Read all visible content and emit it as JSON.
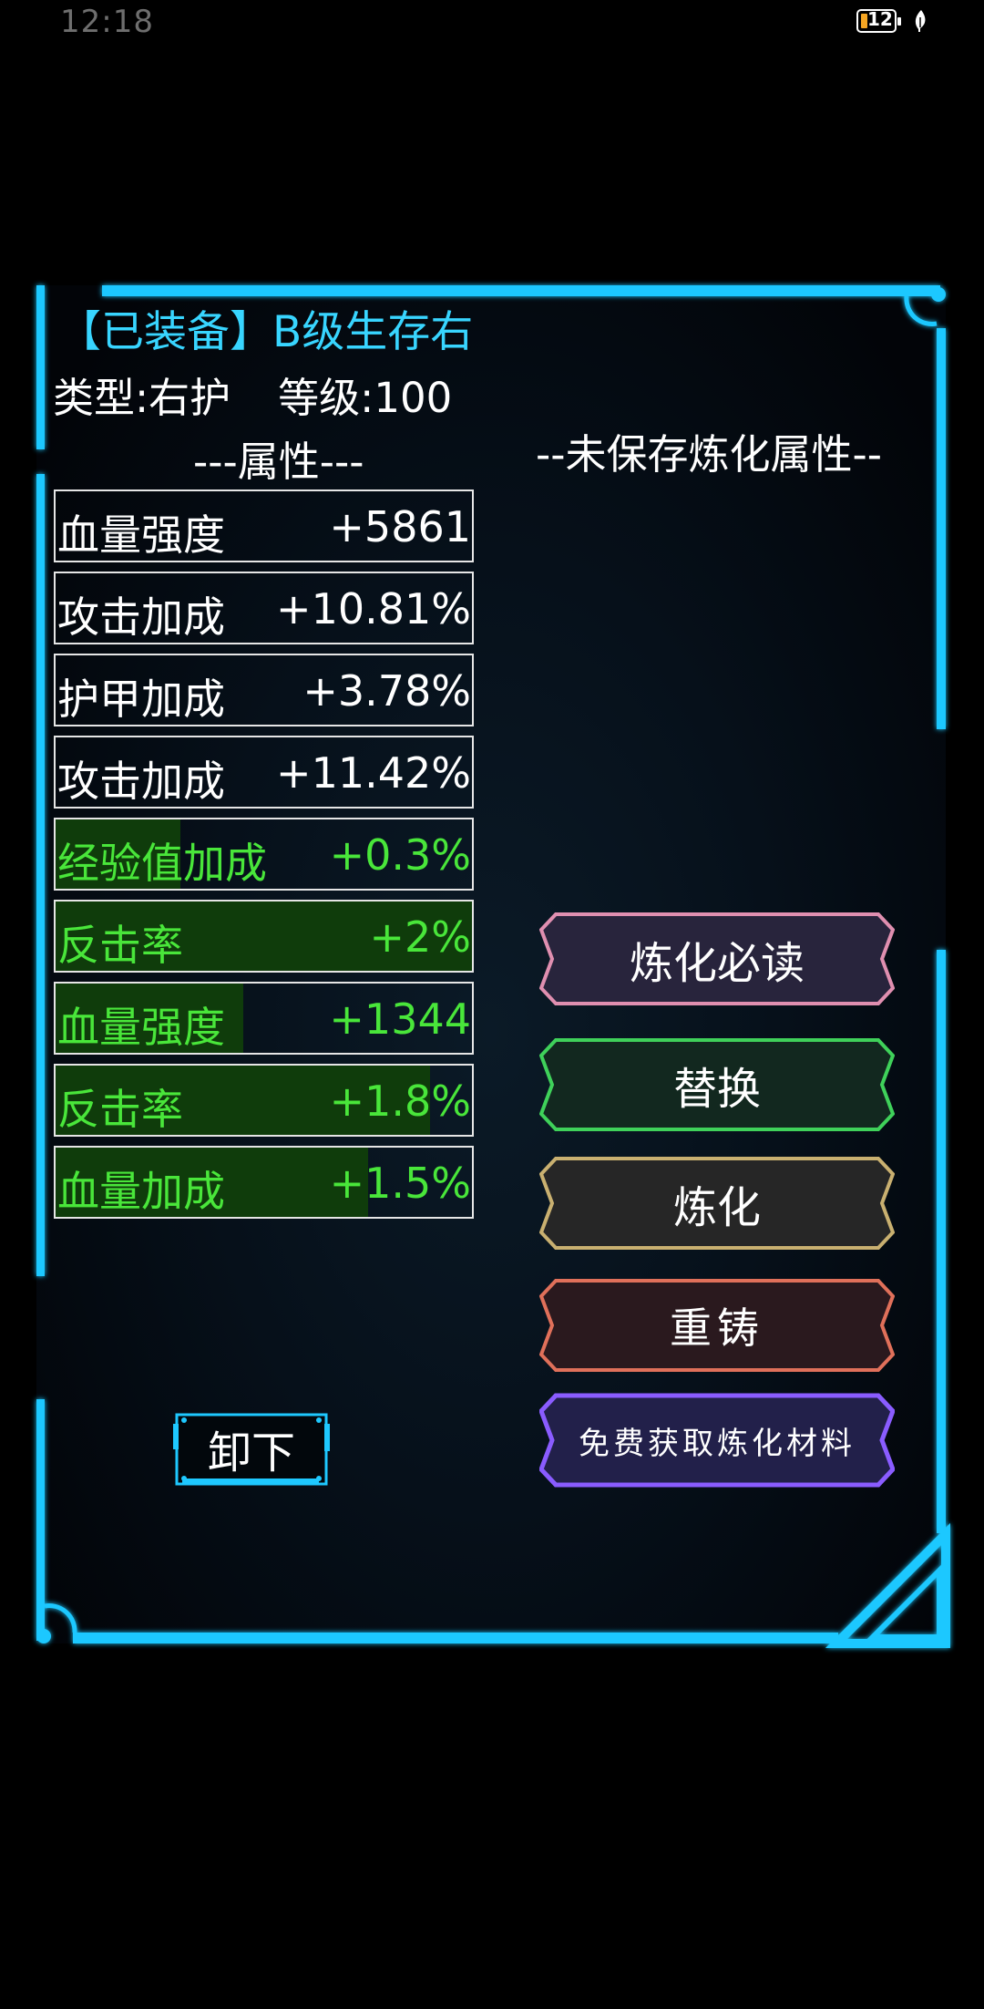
{
  "status_bar": {
    "time": "12:18",
    "battery_level": "12"
  },
  "equipment": {
    "title": "【已装备】B级生存右",
    "type_text": "类型:右护",
    "level_text": "等级:100",
    "attributes_heading": "---属性---",
    "unsaved_heading": "--未保存炼化属性--",
    "attributes": [
      {
        "name": "血量强度",
        "value": "+5861",
        "style": "white",
        "fill": 0
      },
      {
        "name": "攻击加成",
        "value": "+10.81%",
        "style": "white",
        "fill": 0
      },
      {
        "name": "护甲加成",
        "value": "+3.78%",
        "style": "white",
        "fill": 0
      },
      {
        "name": "攻击加成",
        "value": "+11.42%",
        "style": "white",
        "fill": 0
      },
      {
        "name": "经验值加成",
        "value": "+0.3%",
        "style": "green",
        "fill": 0.3
      },
      {
        "name": "反击率",
        "value": "+2%",
        "style": "green",
        "fill": 1.0
      },
      {
        "name": "血量强度",
        "value": "+1344",
        "style": "green",
        "fill": 0.45
      },
      {
        "name": "反击率",
        "value": "+1.8%",
        "style": "green",
        "fill": 0.9
      },
      {
        "name": "血量加成",
        "value": "+1.5%",
        "style": "green",
        "fill": 0.75
      }
    ]
  },
  "buttons": {
    "guide": "炼化必读",
    "replace": "替换",
    "refine": "炼化",
    "reforge": "重铸",
    "free_materials": "免费获取炼化材料",
    "unequip": "卸下"
  },
  "colors": {
    "frame_cyan": "#1ec8ff",
    "title_cyan": "#38d5ff",
    "attr_green": "#49e63a",
    "attr_bar_green": "#0f3c0b",
    "guide_border": "#e08fb0",
    "replace_border": "#3fd15a",
    "refine_border": "#c9b070",
    "reforge_border": "#e0705a",
    "free_border": "#8a5cff"
  }
}
